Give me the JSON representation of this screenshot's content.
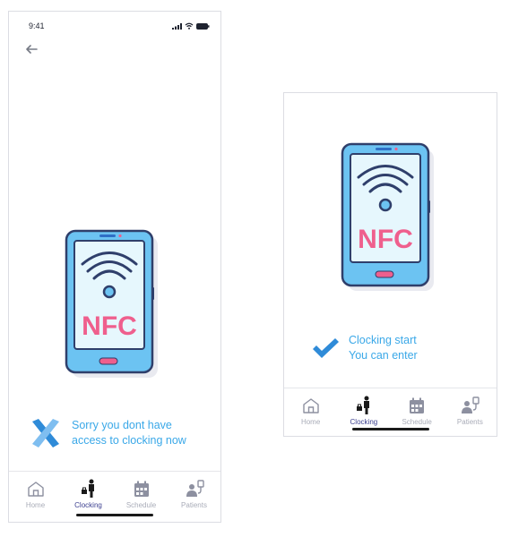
{
  "left_screen": {
    "status_time": "9:41",
    "nfc_label": "NFC",
    "message_lines": [
      "Sorry you dont have",
      "access to clocking now"
    ]
  },
  "right_screen": {
    "nfc_label": "NFC",
    "message_lines": [
      "Clocking start",
      "You can enter"
    ]
  },
  "nav": {
    "items": [
      {
        "label": "Home",
        "icon": "home-icon"
      },
      {
        "label": "Clocking",
        "icon": "clocking-icon",
        "active": true
      },
      {
        "label": "Schedule",
        "icon": "calendar-icon"
      },
      {
        "label": "Patients",
        "icon": "patients-icon"
      }
    ]
  },
  "colors": {
    "accent_blue": "#3aa8e8",
    "nfc_pink": "#ef5f8d",
    "phone_body": "#6cc3f2",
    "phone_screen": "#e6f7fd",
    "outline": "#2f3f6b",
    "error_x_light": "#7fbef0",
    "error_x_dark": "#2f8bd8",
    "nav_active": "#3b3f8f"
  }
}
